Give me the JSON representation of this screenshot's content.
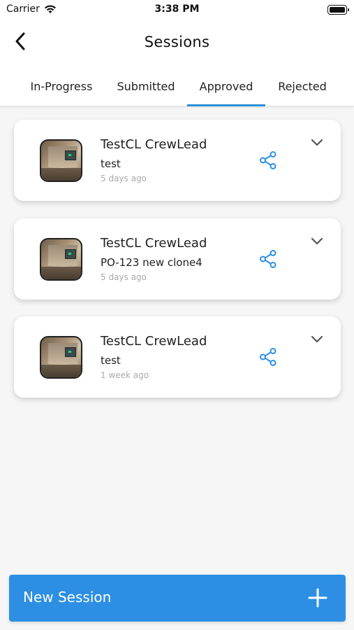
{
  "status_bar": {
    "carrier": "Carrier",
    "time": "3:38 PM"
  },
  "header": {
    "title": "Sessions",
    "back_icon": "chevron-left-icon"
  },
  "tabs": [
    {
      "label": "In-Progress",
      "active": false
    },
    {
      "label": "Submitted",
      "active": false
    },
    {
      "label": "Approved",
      "active": true
    },
    {
      "label": "Rejected",
      "active": false
    }
  ],
  "sessions": [
    {
      "name": "TestCL CrewLead",
      "description": "test",
      "time": "5 days ago"
    },
    {
      "name": "TestCL CrewLead",
      "description": "PO-123 new clone4",
      "time": "5 days ago"
    },
    {
      "name": "TestCL CrewLead",
      "description": "test",
      "time": "1 week ago"
    }
  ],
  "new_session": {
    "label": "New Session",
    "icon": "plus-icon"
  },
  "colors": {
    "accent": "#2d8fe3",
    "tab_underline": "#2d8fd7",
    "share_icon": "#2d8fe3",
    "muted_text": "#a9a9a9",
    "background": "#f6f6f6"
  }
}
